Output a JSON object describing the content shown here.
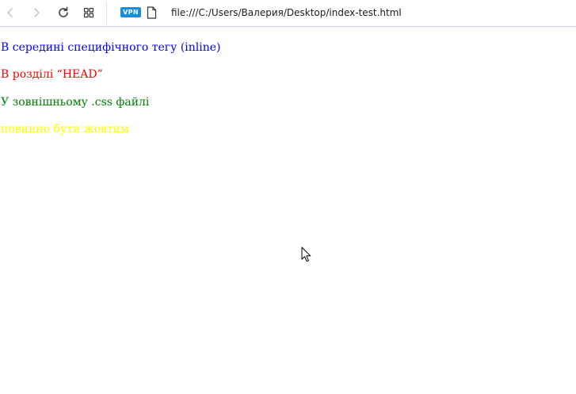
{
  "browser": {
    "vpn_label": "VPN",
    "address": "file:///C:/Users/Валерия/Desktop/index-test.html",
    "icons": {
      "back": "back-arrow-icon",
      "forward": "forward-arrow-icon",
      "reload": "reload-icon",
      "tabs": "tab-grid-icon",
      "page": "page-icon"
    },
    "vpn_color": "#1a8cd8"
  },
  "page": {
    "lines": [
      {
        "text": "В середині специфічного тегу (inline)",
        "color": "#0000ff"
      },
      {
        "text": "В розділі “HEAD”",
        "color": "#ff0000"
      },
      {
        "text": "У зовнішньому .css файлі",
        "color": "#008000"
      },
      {
        "text": "повинно бути жовтим",
        "color": "#ffff00"
      }
    ]
  }
}
